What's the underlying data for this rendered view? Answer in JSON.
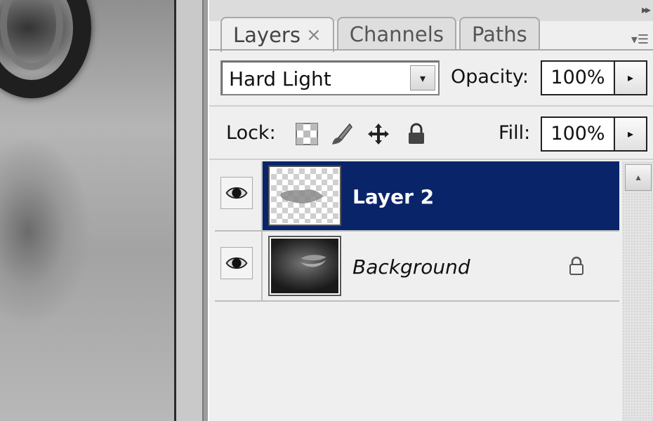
{
  "panel": {
    "tabs": [
      {
        "label": "Layers",
        "close": "×"
      },
      {
        "label": "Channels"
      },
      {
        "label": "Paths"
      }
    ],
    "collapse_glyph": "▸▸",
    "menu_glyph": "▾☰"
  },
  "blend": {
    "mode": "Hard Light",
    "arrow": "▾"
  },
  "opacity": {
    "label": "Opacity:",
    "value": "100%",
    "arrow": "▸"
  },
  "lock": {
    "label": "Lock:",
    "icons": [
      "lock-transparent-pixels-icon",
      "lock-image-pixels-icon",
      "lock-position-icon",
      "lock-all-icon"
    ]
  },
  "fill": {
    "label": "Fill:",
    "value": "100%",
    "arrow": "▸"
  },
  "layers": [
    {
      "name": "Layer 2",
      "selected": true,
      "visible": true,
      "thumbnail": "transparent-with-shape"
    },
    {
      "name": "Background",
      "selected": false,
      "visible": true,
      "thumbnail": "photo",
      "locked": true
    }
  ],
  "scrollbar": {
    "up_arrow": "▴"
  },
  "colors": {
    "selection": "#0a246a",
    "panel_bg": "#efefef"
  }
}
